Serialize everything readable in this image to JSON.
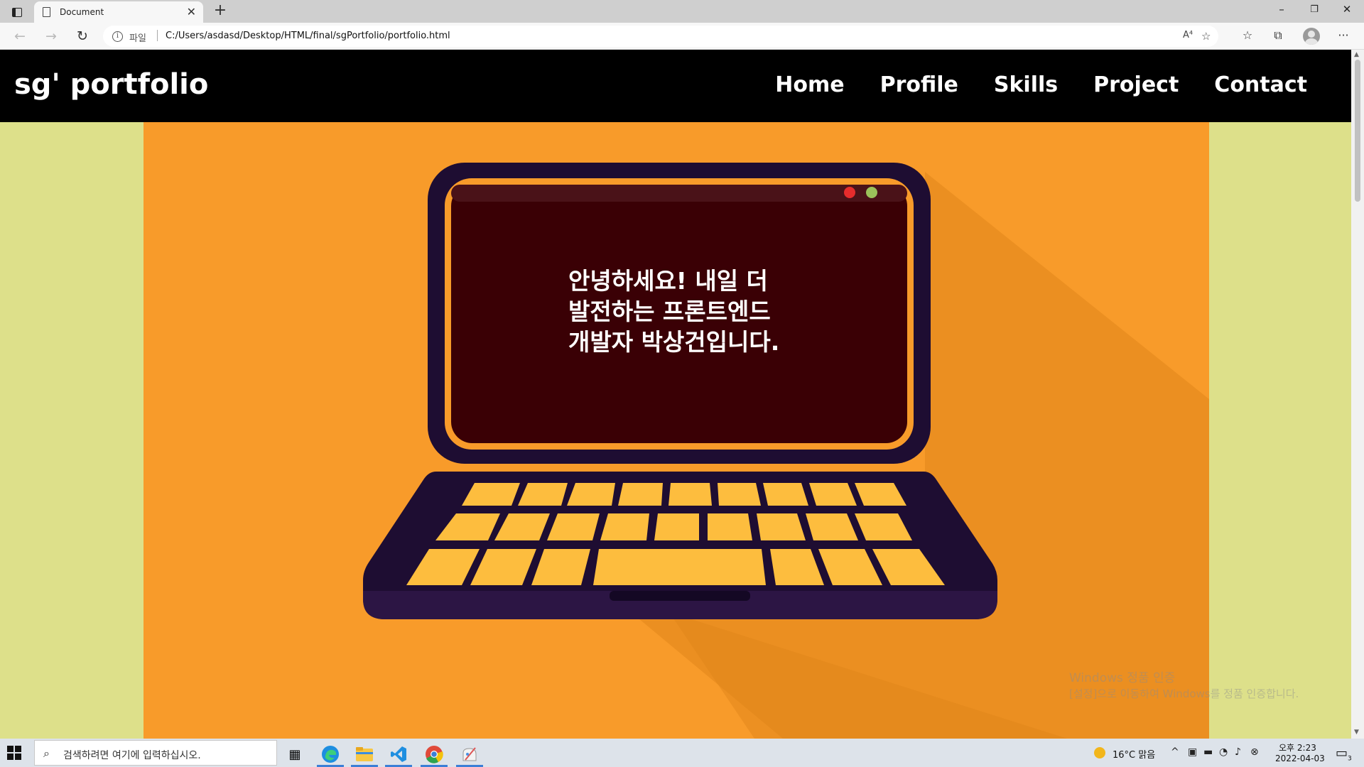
{
  "browser": {
    "tab_title": "Document",
    "tab_close": "✕",
    "new_tab": "+",
    "address_prefix": "파일",
    "address_url": "C:/Users/asdasd/Desktop/HTML/final/sgPortfolio/portfolio.html",
    "window_controls": {
      "minimize": "–",
      "restore": "❐",
      "close": "✕"
    },
    "read_aloud": "A⁴",
    "favorites_add": "☆",
    "favorites": "☆",
    "collections": "⧉",
    "more": "···"
  },
  "page": {
    "logo": "sg' portfolio",
    "nav": [
      "Home",
      "Profile",
      "Skills",
      "Project",
      "Contact"
    ],
    "hero_lines": [
      "안녕하세요! 내일 더",
      "발전하는 프론트엔드",
      "개발자 박상건입니다."
    ],
    "colors": {
      "header": "#000000",
      "side_bg": "#dde08a",
      "hero_bg": "#f89b2a",
      "screen": "#3a0005",
      "laptop_body": "#1e0d32",
      "keys": "#fdbd3e"
    }
  },
  "watermark": {
    "title": "Windows 정품 인증",
    "sub": "[설정]으로 이동하여 Windows를 정품 인증합니다."
  },
  "taskbar": {
    "search_placeholder": "검색하려면 여기에 입력하십시오.",
    "weather": "16°C  맑음",
    "time": "오후 2:23",
    "date": "2022-04-03",
    "notification_count": "3"
  }
}
